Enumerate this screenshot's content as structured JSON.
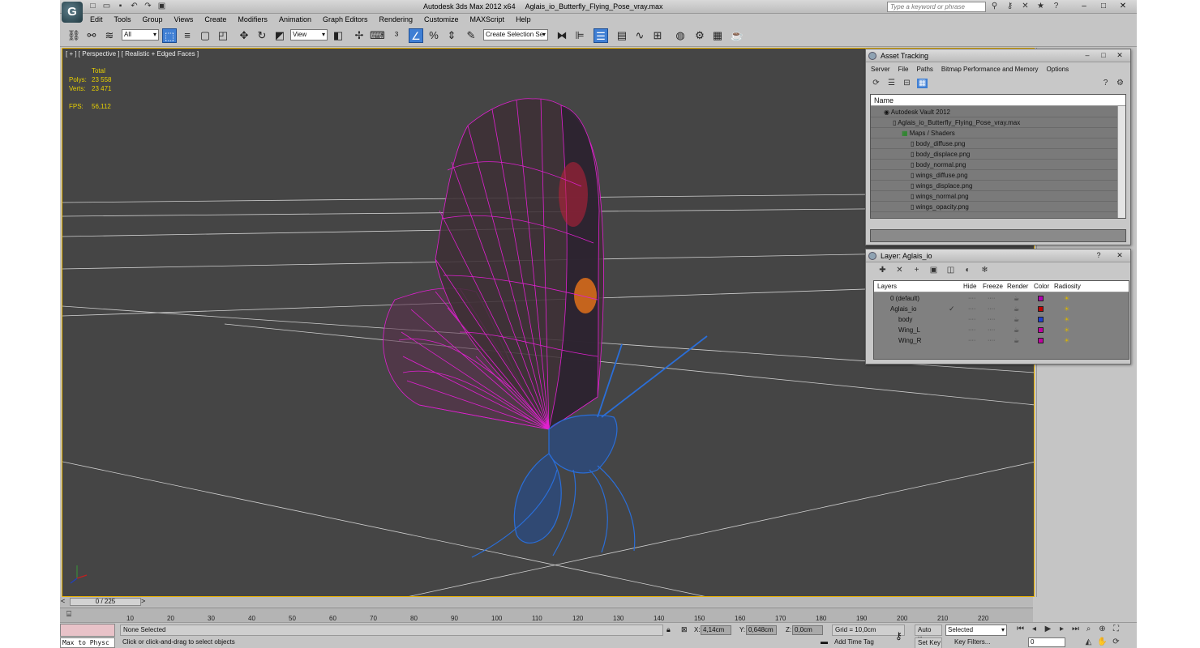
{
  "window": {
    "app_title": "Autodesk 3ds Max  2012 x64",
    "file_title": "Aglais_io_Butterfly_Flying_Pose_vray.max",
    "search_placeholder": "Type a keyword or phrase",
    "logo": "G"
  },
  "menu": [
    "Edit",
    "Tools",
    "Group",
    "Views",
    "Create",
    "Modifiers",
    "Animation",
    "Graph Editors",
    "Rendering",
    "Customize",
    "MAXScript",
    "Help"
  ],
  "toolbar": {
    "filter_select": "All",
    "refcoord_select": "View",
    "selection_set": "Create Selection Se"
  },
  "viewport": {
    "label": "[ + ] [ Perspective ] [ Realistic + Edged Faces ]",
    "stats_header": "Total",
    "polys_label": "Polys:",
    "polys_value": "23 558",
    "verts_label": "Verts:",
    "verts_value": "23 471",
    "fps_label": "FPS:",
    "fps_value": "56,112"
  },
  "timeline": {
    "frame_display": "0 / 225",
    "ticks": [
      "10",
      "20",
      "30",
      "40",
      "50",
      "60",
      "70",
      "80",
      "90",
      "100",
      "110",
      "120",
      "130",
      "140",
      "150",
      "160",
      "170",
      "180",
      "190",
      "200",
      "210",
      "220"
    ]
  },
  "status": {
    "script_text": "Max to Physc",
    "selection": "None Selected",
    "prompt": "Click or click-and-drag to select objects",
    "x_label": "X:",
    "x_value": "4,14cm",
    "y_label": "Y:",
    "y_value": "0,648cm",
    "z_label": "Z:",
    "z_value": "0,0cm",
    "grid": "Grid = 10,0cm",
    "add_time_tag": "Add Time Tag",
    "auto_key": "Auto Key",
    "set_key": "Set Key",
    "key_mode_select": "Selected",
    "key_filters": "Key Filters...",
    "frame_field": "0"
  },
  "asset_tracking": {
    "title": "Asset Tracking",
    "menu": [
      "Server",
      "File",
      "Paths",
      "Bitmap Performance and Memory",
      "Options"
    ],
    "column_name": "Name",
    "rows": [
      {
        "label": "Autodesk Vault 2012",
        "indent": 0
      },
      {
        "label": "Aglais_io_Butterfly_Flying_Pose_vray.max",
        "indent": 1
      },
      {
        "label": "Maps / Shaders",
        "indent": 2
      },
      {
        "label": "body_diffuse.png",
        "indent": 3
      },
      {
        "label": "body_displace.png",
        "indent": 3
      },
      {
        "label": "body_normal.png",
        "indent": 3
      },
      {
        "label": "wings_diffuse.png",
        "indent": 3
      },
      {
        "label": "wings_displace.png",
        "indent": 3
      },
      {
        "label": "wings_normal.png",
        "indent": 3
      },
      {
        "label": "wings_opacity.png",
        "indent": 3
      }
    ]
  },
  "layer_dialog": {
    "title": "Layer: Aglais_io",
    "help_button": "?",
    "columns": {
      "layers": "Layers",
      "hide": "Hide",
      "freeze": "Freeze",
      "render": "Render",
      "color": "Color",
      "radiosity": "Radiosity"
    },
    "rows": [
      {
        "label": "0 (default)",
        "indent": 1,
        "color": "#b000b0"
      },
      {
        "label": "Aglais_io",
        "indent": 1,
        "color": "#c00000"
      },
      {
        "label": "body",
        "indent": 2,
        "color": "#1f3fd0"
      },
      {
        "label": "Wing_L",
        "indent": 2,
        "color": "#c000a0"
      },
      {
        "label": "Wing_R",
        "indent": 2,
        "color": "#c000a0"
      }
    ]
  },
  "colors": {
    "viewport_bg": "#454545",
    "wing_wire": "#e020d0",
    "body_wire": "#2a6ed8",
    "active_border": "#eab300",
    "accent": "#3f7fd4"
  }
}
